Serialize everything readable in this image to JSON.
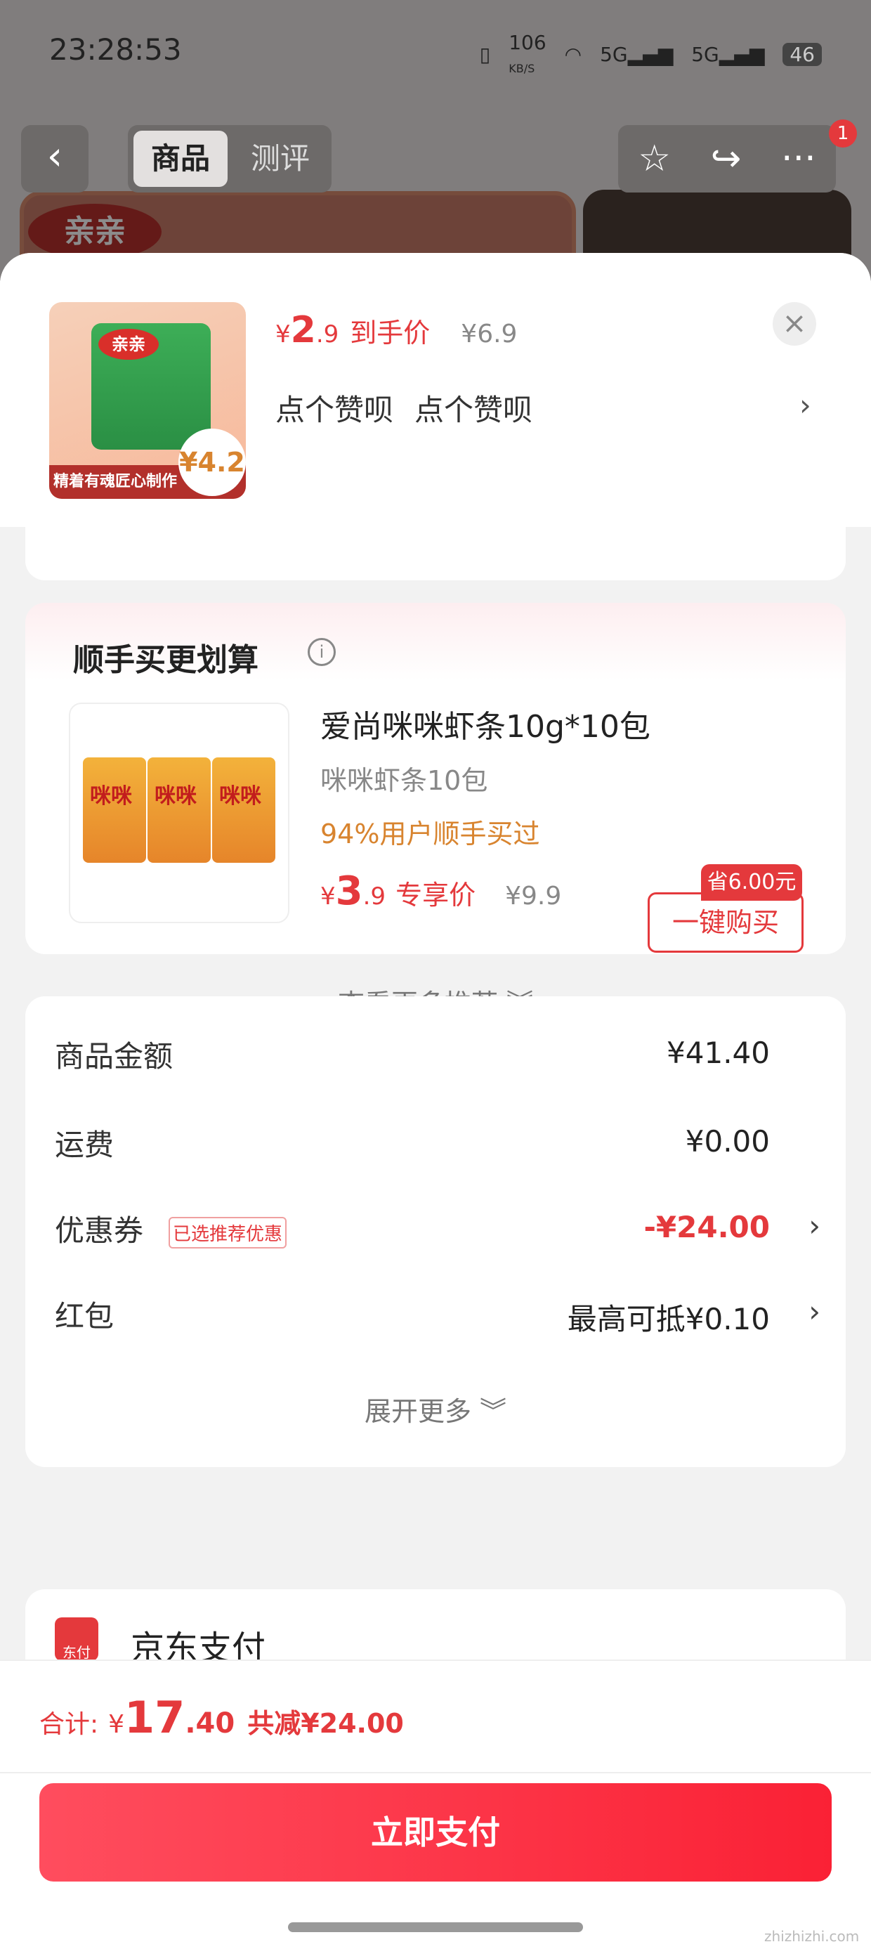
{
  "status_bar": {
    "time": "23:28:53",
    "net_speed": "106",
    "net_unit": "KB/S",
    "sig1": "5G",
    "sig2": "5G",
    "battery": "46"
  },
  "nav": {
    "back": "‹",
    "tab_goods": "商品",
    "tab_review": "测评",
    "star": "☆",
    "share": "↪",
    "more": "···",
    "badge": "1"
  },
  "bg": {
    "logo": "亲亲"
  },
  "product": {
    "logo": "亲亲",
    "strip": "精着有魂匠心制作",
    "badge": "¥4.2",
    "price_symbol": "¥",
    "price_int": "2",
    "price_dec": ".9",
    "price_tag": "到手价",
    "orig_price": "¥6.9",
    "spec1": "点个赞呗",
    "spec2": "点个赞呗",
    "spec_arrow": "›",
    "close": "×"
  },
  "reco": {
    "title": "顺手买更划算",
    "info": "i",
    "snack_label": "咪咪",
    "name": "爱尚咪咪虾条10g*10包",
    "sub": "咪咪虾条10包",
    "users": "94%用户顺手买过",
    "price_symbol": "¥",
    "price_int": "3",
    "price_dec": ".9",
    "price_tag": "专享价",
    "orig_price": "¥9.9",
    "save": "省6.00元",
    "buy": "一键购买",
    "more": "查看更多推荐 ︾"
  },
  "summary": {
    "goods_label": "商品金额",
    "goods_value": "¥41.40",
    "ship_label": "运费",
    "ship_value": "¥0.00",
    "coupon_label": "优惠券",
    "coupon_tag": "已选推荐优惠",
    "coupon_value": "-¥24.00",
    "redpack_label": "红包",
    "redpack_value": "最高可抵¥0.10",
    "chev": "›",
    "expand": "展开更多 ︾"
  },
  "payment": {
    "icon": "东付",
    "name": "京东支付"
  },
  "footer": {
    "total_label": "合计:",
    "sym": "¥",
    "total_int": "17",
    "total_dec": ".40",
    "reduce": "共减¥24.00",
    "pay_button": "立即支付",
    "watermark": "zhizhizhi.com"
  },
  "colors": {
    "accent": "#e4393c",
    "orange": "#d8842f"
  }
}
